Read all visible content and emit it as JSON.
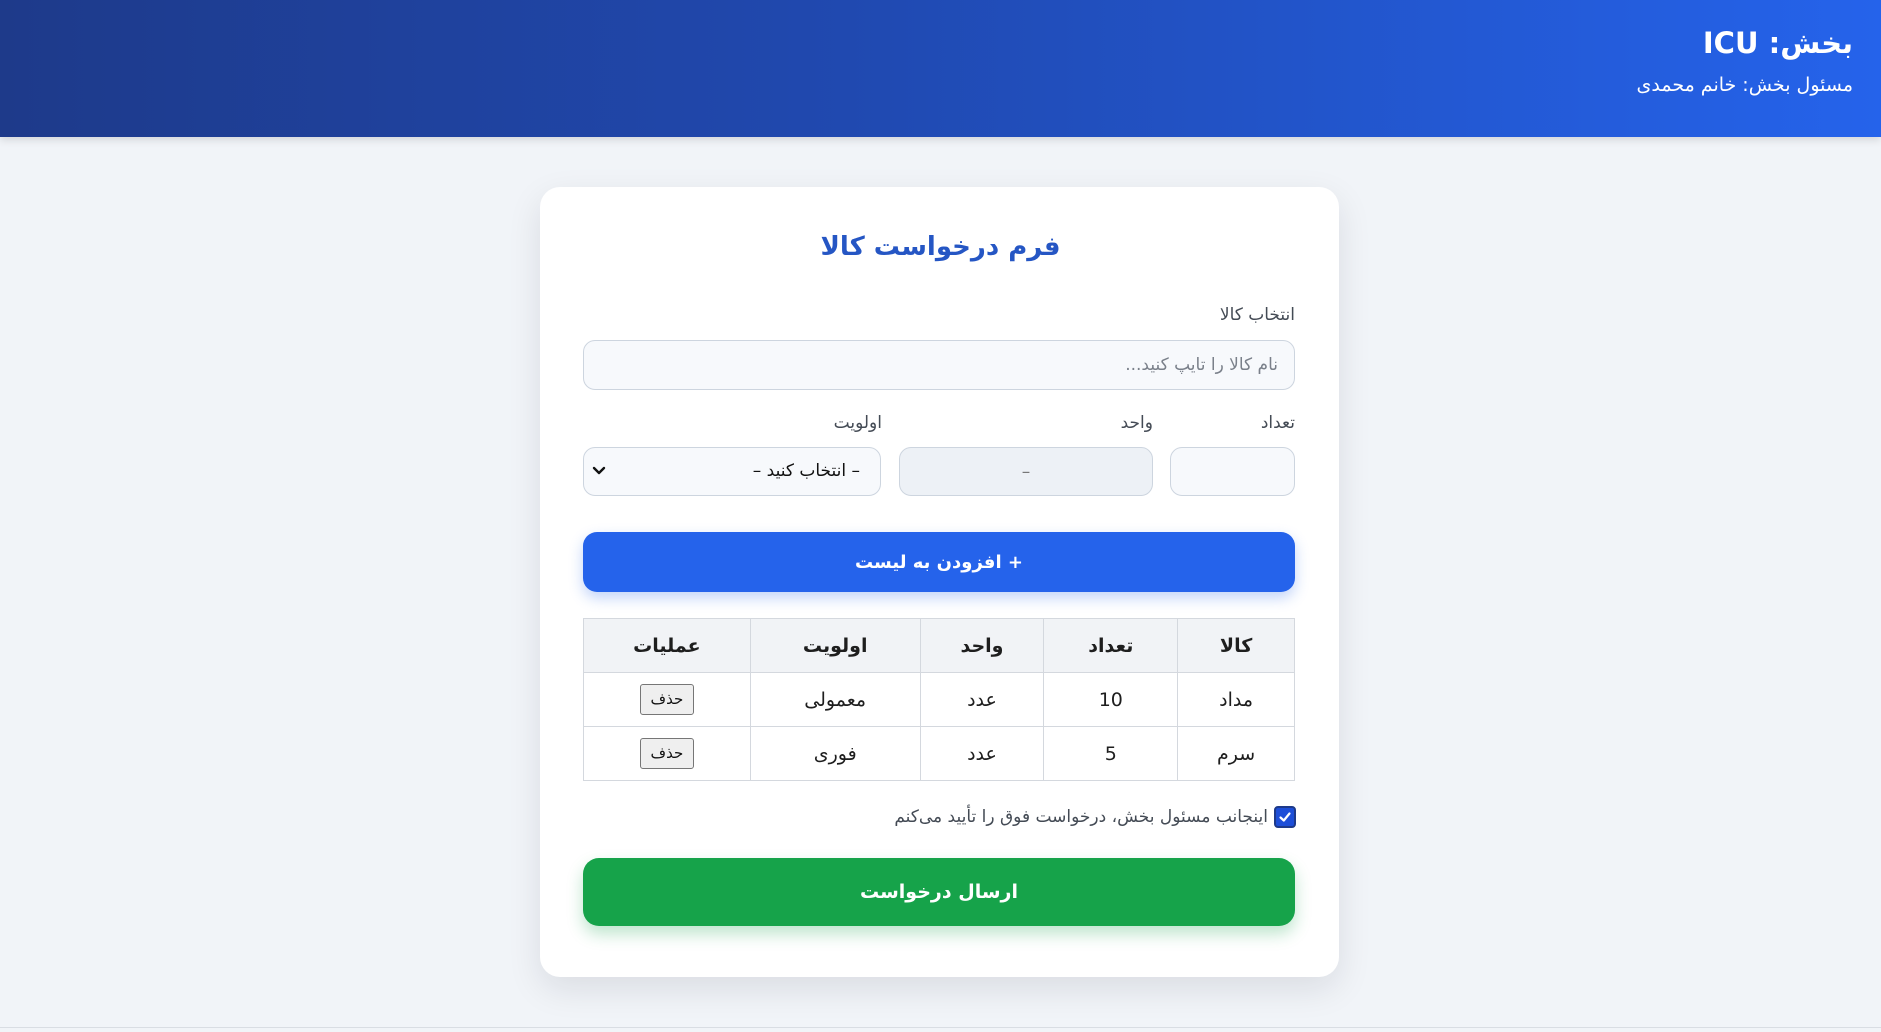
{
  "header": {
    "title": "بخش: ICU",
    "subtitle": "مسئول بخش: خانم محمدی"
  },
  "form": {
    "title": "فرم درخواست کالا",
    "item_label": "انتخاب کالا",
    "item_placeholder": "نام کالا را تایپ کنید...",
    "quantity_label": "تعداد",
    "quantity_value": "",
    "unit_label": "واحد",
    "unit_value": "–",
    "priority_label": "اولویت",
    "priority_selected": "– انتخاب کنید –",
    "add_button": "+ افزودن به لیست",
    "confirm_text": "اینجانب مسئول بخش، درخواست فوق را تأیید می‌کنم",
    "confirm_checked": true,
    "submit_button": "ارسال درخواست"
  },
  "table": {
    "headers": {
      "item": "کالا",
      "quantity": "تعداد",
      "unit": "واحد",
      "priority": "اولویت",
      "actions": "عملیات"
    },
    "rows": [
      {
        "item": "مداد",
        "quantity": "10",
        "unit": "عدد",
        "priority": "معمولی",
        "action": "حذف"
      },
      {
        "item": "سرم",
        "quantity": "5",
        "unit": "عدد",
        "priority": "فوری",
        "action": "حذف"
      }
    ]
  },
  "colors": {
    "header_start": "#1e3a8a",
    "header_end": "#2563eb",
    "primary": "#2563eb",
    "success": "#16a34a",
    "title": "#2556c4"
  },
  "icons": {
    "priority_dropdown": "chevron-down-icon",
    "confirm_checkbox": "check-icon"
  }
}
